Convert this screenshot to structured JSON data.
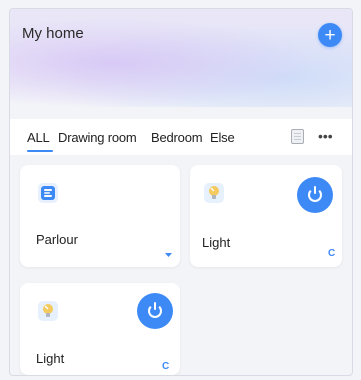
{
  "header": {
    "title": "My home",
    "add_label": "+"
  },
  "tabs": [
    {
      "label": "ALL"
    },
    {
      "label": "Drawing room"
    },
    {
      "label": "Bedroom"
    },
    {
      "label": "Else"
    }
  ],
  "tabs_more": "•••",
  "cards": [
    {
      "name": "Parlour"
    },
    {
      "name": "Light",
      "status": "C"
    },
    {
      "name": "Light",
      "status": "C"
    }
  ],
  "colors": {
    "accent": "#3d8af7",
    "tile_bg": "#e6f1fd"
  },
  "icons": {
    "add": "plus-icon",
    "list": "list-icon",
    "more": "more-icon",
    "scene": "scene-icon",
    "bulb": "bulb-icon",
    "power": "power-icon",
    "dropdown": "dropdown-icon",
    "refresh": "refresh-icon"
  }
}
